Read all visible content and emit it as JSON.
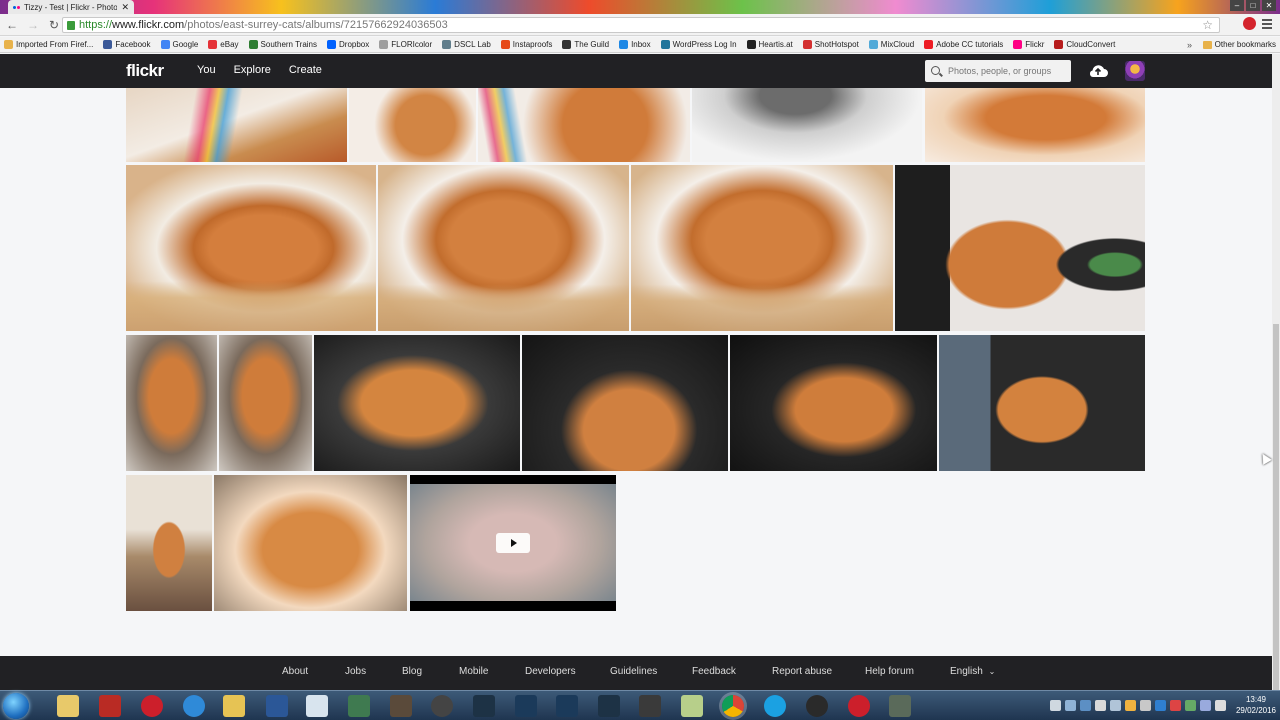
{
  "browser": {
    "tab_title": "Tizzy - Test | Flickr - Photo",
    "url_scheme": "https://",
    "url_host": "www.flickr.com",
    "url_path": "/photos/east-surrey-cats/albums/72157662924036503",
    "bookmarks": [
      {
        "label": "Imported From Firef...",
        "icon": "folder-icon",
        "color": "#e8b24a"
      },
      {
        "label": "Facebook",
        "icon": "facebook-icon",
        "color": "#3b5998"
      },
      {
        "label": "Google",
        "icon": "google-icon",
        "color": "#4285f4"
      },
      {
        "label": "eBay",
        "icon": "ebay-icon",
        "color": "#e53238"
      },
      {
        "label": "Southern Trains",
        "icon": "trains-icon",
        "color": "#2e7d32"
      },
      {
        "label": "Dropbox",
        "icon": "dropbox-icon",
        "color": "#0061fe"
      },
      {
        "label": "FLORIcolor",
        "icon": "floricolor-icon",
        "color": "#9e9e9e"
      },
      {
        "label": "DSCL Lab",
        "icon": "dscl-icon",
        "color": "#607d8b"
      },
      {
        "label": "Instaproofs",
        "icon": "instaproofs-icon",
        "color": "#e64a19"
      },
      {
        "label": "The Guild",
        "icon": "guild-icon",
        "color": "#333333"
      },
      {
        "label": "Inbox",
        "icon": "inbox-icon",
        "color": "#1e88e5"
      },
      {
        "label": "WordPress Log In",
        "icon": "wordpress-icon",
        "color": "#21759b"
      },
      {
        "label": "Heartis.at",
        "icon": "heartis-icon",
        "color": "#222222"
      },
      {
        "label": "ShotHotspot",
        "icon": "shothotspot-icon",
        "color": "#d32f2f"
      },
      {
        "label": "MixCloud",
        "icon": "mixcloud-icon",
        "color": "#52aad8"
      },
      {
        "label": "Adobe CC tutorials",
        "icon": "adobe-icon",
        "color": "#ed1c24"
      },
      {
        "label": "Flickr",
        "icon": "flickr-icon",
        "color": "#ff0084"
      },
      {
        "label": "CloudConvert",
        "icon": "cloudconvert-icon",
        "color": "#b71c1c"
      }
    ],
    "bookmarks_more": "»",
    "other_bookmarks": "Other bookmarks"
  },
  "flickr": {
    "logo": "flickr",
    "nav": [
      "You",
      "Explore",
      "Create"
    ],
    "search_placeholder": "Photos, people, or groups"
  },
  "footer": {
    "links": [
      "About",
      "Jobs",
      "Blog",
      "Mobile",
      "Developers",
      "Guidelines",
      "Feedback",
      "Report abuse",
      "Help forum"
    ],
    "language": "English"
  },
  "taskbar": {
    "time": "13:49",
    "date": "29/02/2016"
  }
}
